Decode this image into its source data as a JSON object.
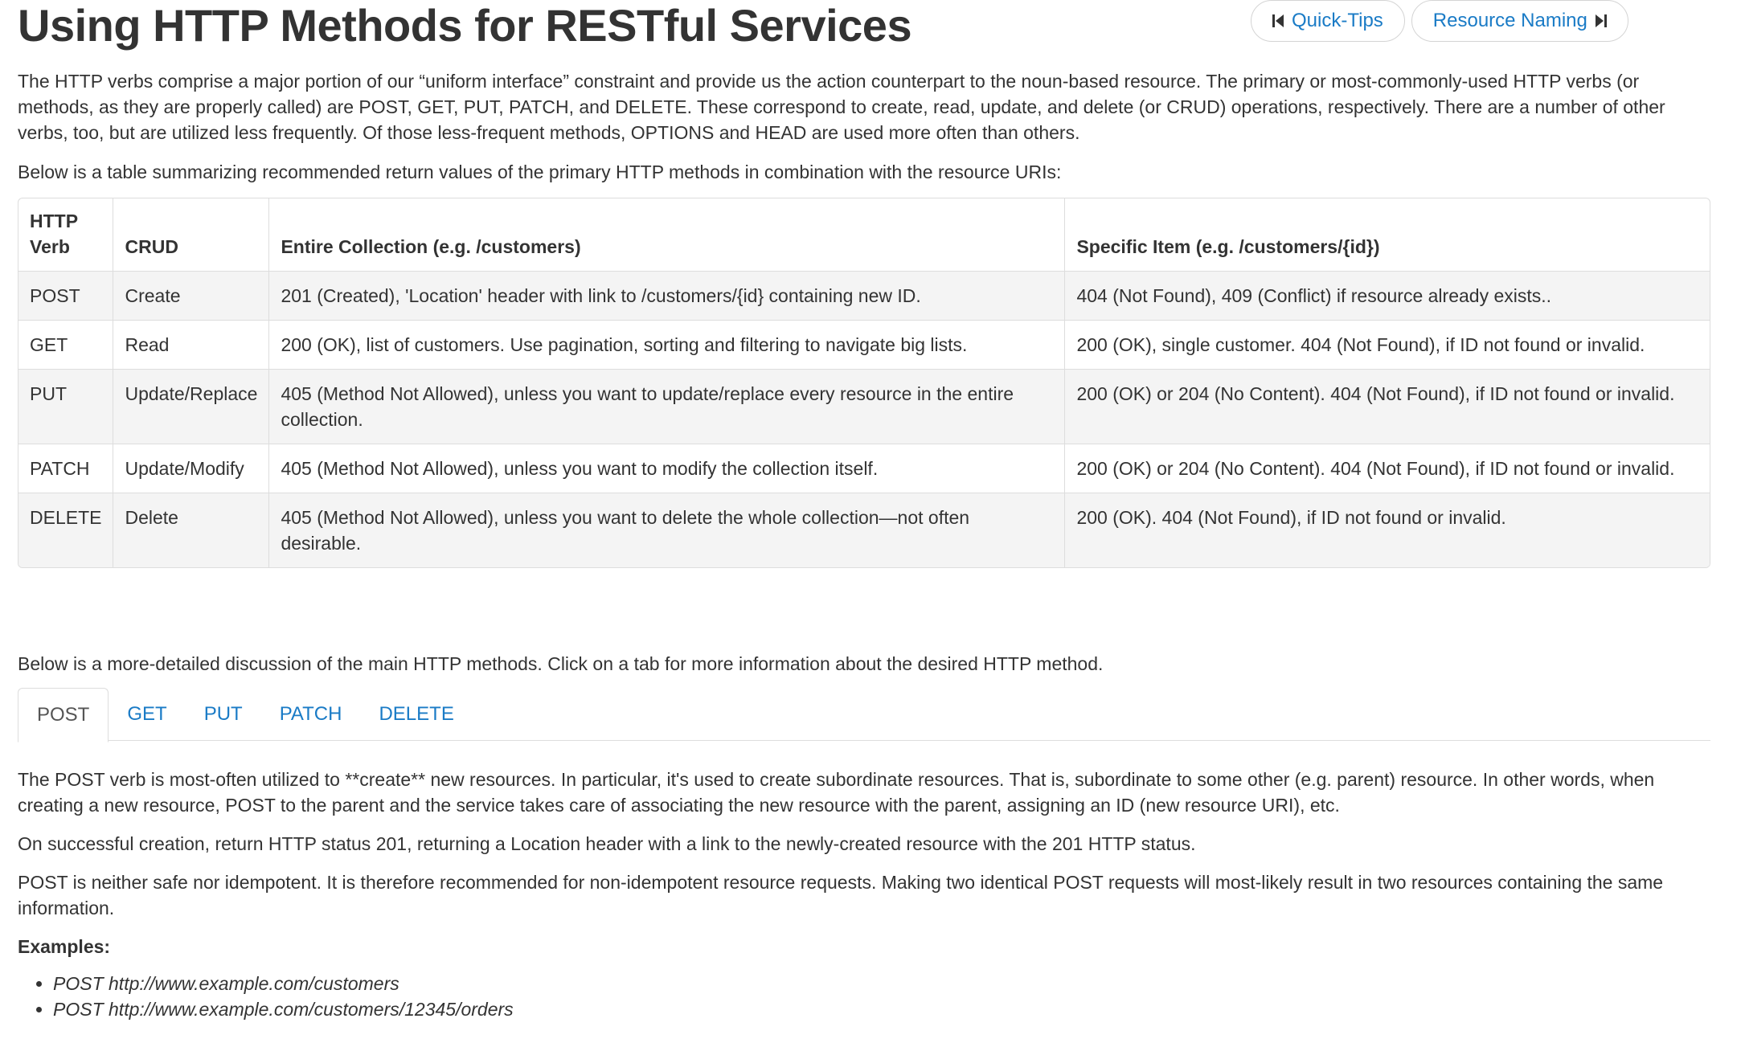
{
  "header": {
    "title": "Using HTTP Methods for RESTful Services",
    "prev_button": {
      "label": "Quick-Tips",
      "icon": "skip-back-icon"
    },
    "next_button": {
      "label": "Resource Naming",
      "icon": "skip-forward-icon"
    }
  },
  "intro": {
    "paragraph": "The HTTP verbs comprise a major portion of our “uniform interface” constraint and provide us the action counterpart to the noun-based resource. The primary or most-commonly-used HTTP verbs (or methods, as they are properly called) are POST, GET, PUT, PATCH, and DELETE. These correspond to create, read, update, and delete (or CRUD) operations, respectively. There are a number of other verbs, too, but are utilized less frequently. Of those less-frequent methods, OPTIONS and HEAD are used more often than others.",
    "table_intro": "Below is a table summarizing recommended return values of the primary HTTP methods in combination with the resource URIs:"
  },
  "table": {
    "headers": {
      "verb_line1": "HTTP",
      "verb_line2": "Verb",
      "crud": "CRUD",
      "collection": "Entire Collection (e.g. /customers)",
      "item": "Specific Item (e.g. /customers/{id})"
    },
    "rows": [
      {
        "verb": "POST",
        "crud": "Create",
        "collection": "201 (Created), 'Location' header with link to /customers/{id} containing new ID.",
        "item": "404 (Not Found), 409 (Conflict) if resource already exists.."
      },
      {
        "verb": "GET",
        "crud": "Read",
        "collection": "200 (OK), list of customers. Use pagination, sorting and filtering to navigate big lists.",
        "item": "200 (OK), single customer. 404 (Not Found), if ID not found or invalid."
      },
      {
        "verb": "PUT",
        "crud": "Update/Replace",
        "collection": "405 (Method Not Allowed), unless you want to update/replace every resource in the entire collection.",
        "item": "200 (OK) or 204 (No Content). 404 (Not Found), if ID not found or invalid."
      },
      {
        "verb": "PATCH",
        "crud": "Update/Modify",
        "collection": "405 (Method Not Allowed), unless you want to modify the collection itself.",
        "item": "200 (OK) or 204 (No Content). 404 (Not Found), if ID not found or invalid."
      },
      {
        "verb": "DELETE",
        "crud": "Delete",
        "collection": "405 (Method Not Allowed), unless you want to delete the whole collection—not often desirable.",
        "item": "200 (OK). 404 (Not Found), if ID not found or invalid."
      }
    ]
  },
  "discussion_intro": "Below is a more-detailed discussion of the main HTTP methods. Click on a tab for more information about the desired HTTP method.",
  "tabs": [
    {
      "label": "POST",
      "active": true
    },
    {
      "label": "GET",
      "active": false
    },
    {
      "label": "PUT",
      "active": false
    },
    {
      "label": "PATCH",
      "active": false
    },
    {
      "label": "DELETE",
      "active": false
    }
  ],
  "post_tab": {
    "p1": "The POST verb is most-often utilized to **create** new resources. In particular, it's used to create subordinate resources. That is, subordinate to some other (e.g. parent) resource. In other words, when creating a new resource, POST to the parent and the service takes care of associating the new resource with the parent, assigning an ID (new resource URI), etc.",
    "p2": "On successful creation, return HTTP status 201, returning a Location header with a link to the newly-created resource with the 201 HTTP status.",
    "p3": "POST is neither safe nor idempotent. It is therefore recommended for non-idempotent resource requests. Making two identical POST requests will most-likely result in two resources containing the same information.",
    "examples_heading": "Examples:",
    "examples": [
      "POST http://www.example.com/customers",
      "POST http://www.example.com/customers/12345/orders"
    ]
  },
  "colors": {
    "link": "#1a7bc6",
    "text": "#333333",
    "border": "#dddddd",
    "stripe": "#f4f4f4"
  }
}
